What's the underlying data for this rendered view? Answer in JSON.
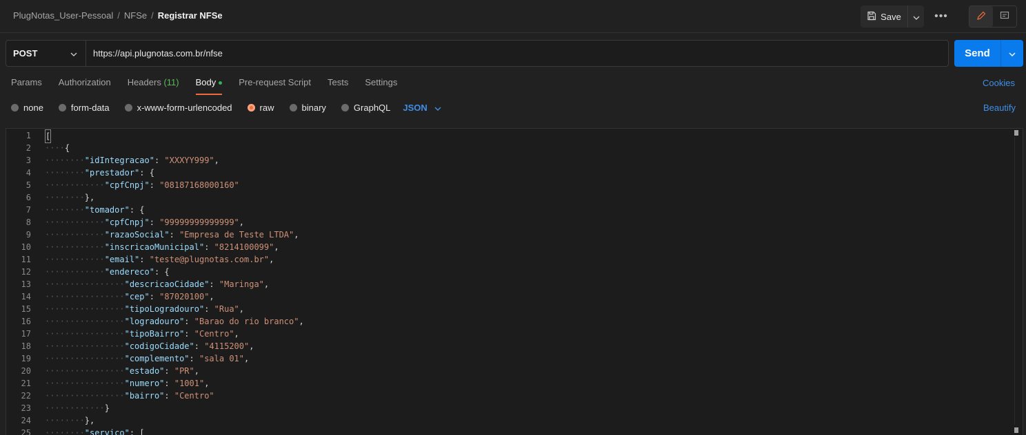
{
  "breadcrumb": {
    "workspace": "PlugNotas_User-Pessoal",
    "separator": "/",
    "collection": "NFSe",
    "request": "Registrar NFSe"
  },
  "toolbar": {
    "save_label": "Save",
    "more_label": "•••"
  },
  "request": {
    "method": "POST",
    "url": "https://api.plugnotas.com.br/nfse",
    "send_label": "Send"
  },
  "tabs": {
    "params": "Params",
    "authorization": "Authorization",
    "headers": "Headers",
    "headers_count": "(11)",
    "body": "Body",
    "pre_request": "Pre-request Script",
    "tests": "Tests",
    "settings": "Settings",
    "cookies": "Cookies"
  },
  "body_types": {
    "none": "none",
    "form_data": "form-data",
    "urlencoded": "x-www-form-urlencoded",
    "raw": "raw",
    "binary": "binary",
    "graphql": "GraphQL",
    "language": "JSON",
    "beautify": "Beautify",
    "selected": "raw"
  },
  "colors": {
    "accent": "#f26b3a",
    "link": "#3f8fe6",
    "send": "#097bed",
    "key": "#9cdcfe",
    "string": "#ce9178"
  },
  "editor": {
    "lines": [
      {
        "n": "1",
        "indent": 0,
        "text": "["
      },
      {
        "n": "2",
        "indent": 1,
        "text": "{"
      },
      {
        "n": "3",
        "indent": 2,
        "key": "\"idIntegracao\"",
        "val": "\"XXXYY999\"",
        "end": ","
      },
      {
        "n": "4",
        "indent": 2,
        "key": "\"prestador\"",
        "text": "{"
      },
      {
        "n": "5",
        "indent": 3,
        "key": "\"cpfCnpj\"",
        "val": "\"08187168000160\"",
        "end": ""
      },
      {
        "n": "6",
        "indent": 2,
        "text": "},"
      },
      {
        "n": "7",
        "indent": 2,
        "key": "\"tomador\"",
        "text": "{"
      },
      {
        "n": "8",
        "indent": 3,
        "key": "\"cpfCnpj\"",
        "val": "\"99999999999999\"",
        "end": ","
      },
      {
        "n": "9",
        "indent": 3,
        "key": "\"razaoSocial\"",
        "val": "\"Empresa de Teste LTDA\"",
        "end": ","
      },
      {
        "n": "10",
        "indent": 3,
        "key": "\"inscricaoMunicipal\"",
        "val": "\"8214100099\"",
        "end": ","
      },
      {
        "n": "11",
        "indent": 3,
        "key": "\"email\"",
        "val": "\"teste@plugnotas.com.br\"",
        "end": ","
      },
      {
        "n": "12",
        "indent": 3,
        "key": "\"endereco\"",
        "text": "{"
      },
      {
        "n": "13",
        "indent": 4,
        "key": "\"descricaoCidade\"",
        "val": "\"Maringa\"",
        "end": ","
      },
      {
        "n": "14",
        "indent": 4,
        "key": "\"cep\"",
        "val": "\"87020100\"",
        "end": ","
      },
      {
        "n": "15",
        "indent": 4,
        "key": "\"tipoLogradouro\"",
        "val": "\"Rua\"",
        "end": ","
      },
      {
        "n": "16",
        "indent": 4,
        "key": "\"logradouro\"",
        "val": "\"Barao do rio branco\"",
        "end": ","
      },
      {
        "n": "17",
        "indent": 4,
        "key": "\"tipoBairro\"",
        "val": "\"Centro\"",
        "end": ","
      },
      {
        "n": "18",
        "indent": 4,
        "key": "\"codigoCidade\"",
        "val": "\"4115200\"",
        "end": ","
      },
      {
        "n": "19",
        "indent": 4,
        "key": "\"complemento\"",
        "val": "\"sala 01\"",
        "end": ","
      },
      {
        "n": "20",
        "indent": 4,
        "key": "\"estado\"",
        "val": "\"PR\"",
        "end": ","
      },
      {
        "n": "21",
        "indent": 4,
        "key": "\"numero\"",
        "val": "\"1001\"",
        "end": ","
      },
      {
        "n": "22",
        "indent": 4,
        "key": "\"bairro\"",
        "val": "\"Centro\"",
        "end": ""
      },
      {
        "n": "23",
        "indent": 3,
        "text": "}"
      },
      {
        "n": "24",
        "indent": 2,
        "text": "},"
      },
      {
        "n": "25",
        "indent": 2,
        "key": "\"servico\"",
        "text": "["
      }
    ]
  }
}
